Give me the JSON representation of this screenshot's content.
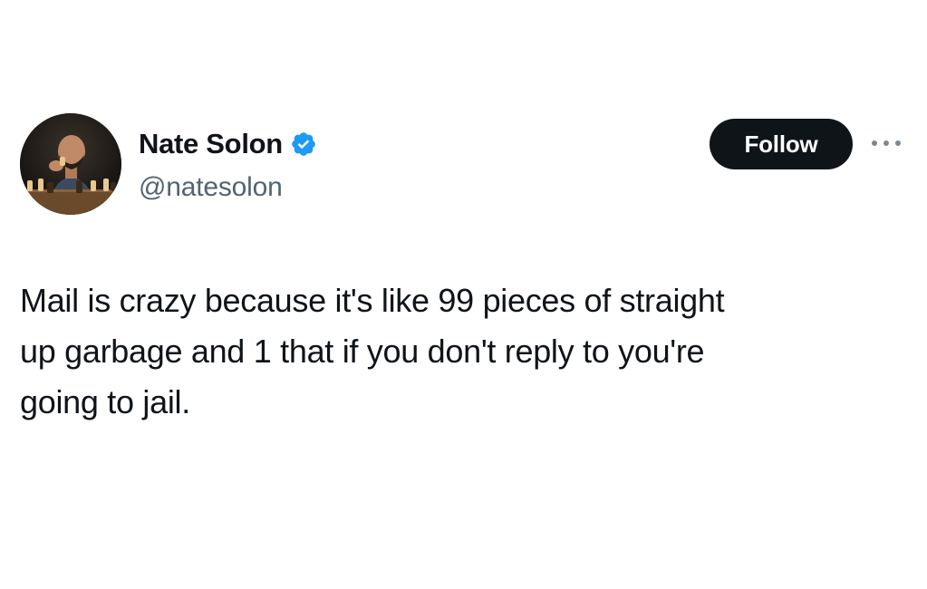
{
  "tweet": {
    "author": {
      "display_name": "Nate Solon",
      "handle": "@natesolon",
      "verified": true,
      "avatar_icon": "profile-photo-chess"
    },
    "follow_label": "Follow",
    "more_icon": "ellipsis-icon",
    "text": "Mail is crazy because it's like 99 pieces of straight\nup garbage and 1 that if you don't reply to you're\ngoing to jail."
  },
  "colors": {
    "text_primary": "#0f1419",
    "text_secondary": "#536471",
    "verified_badge": "#1d9bf0",
    "follow_button_bg": "#0f1419",
    "follow_button_text": "#ffffff"
  }
}
